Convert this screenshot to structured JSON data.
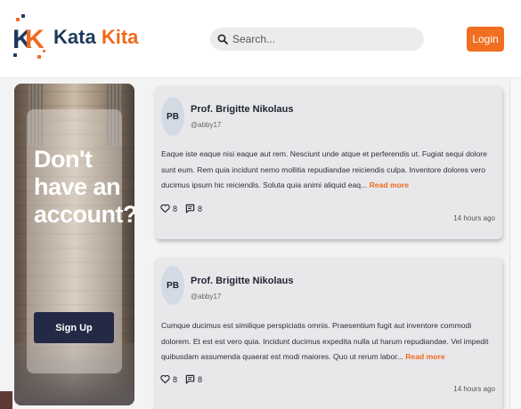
{
  "header": {
    "logo_letters": "KK",
    "logo_kata": "Kata",
    "logo_kita": "Kita",
    "search_placeholder": "Search...",
    "login_label": "Login"
  },
  "promo": {
    "heading": "Don't have an account?",
    "signup_label": "Sign Up"
  },
  "posts": [
    {
      "initials": "PB",
      "author": "Prof. Brigitte Nikolaus",
      "handle": "@abby17",
      "body": "Eaque iste eaque nisi eaque aut rem. Nesciunt unde atque et perferendis ut. Fugiat sequi dolore sunt eum. Rem quia incidunt nemo mollitia repudiandae reiciendis culpa. Inventore dolores vero ducimus ipsum hic reiciendis. Soluta quia animi aliquid eaq...",
      "read_more": "Read more",
      "likes": "8",
      "comments": "8",
      "time": "14 hours ago"
    },
    {
      "initials": "PB",
      "author": "Prof. Brigitte Nikolaus",
      "handle": "@abby17",
      "body": "Cumque ducimus est similique perspiciatis omnis. Praesentium fugit aut inventore commodi dolorem. Et est est vero quia. Incidunt ducimus expedita nulla ut harum repudiandae. Vel impedit quibusdam assumenda quaerat est modi maiores. Quo ut rerum labor...",
      "read_more": "Read more",
      "likes": "8",
      "comments": "8",
      "time": "14 hours ago"
    }
  ],
  "icons": {
    "search": "search-icon",
    "like": "heart-icon",
    "comment": "comment-icon"
  },
  "colors": {
    "accent": "#f26f21",
    "brand_dark": "#1d3a5c",
    "signup": "#242a45"
  }
}
